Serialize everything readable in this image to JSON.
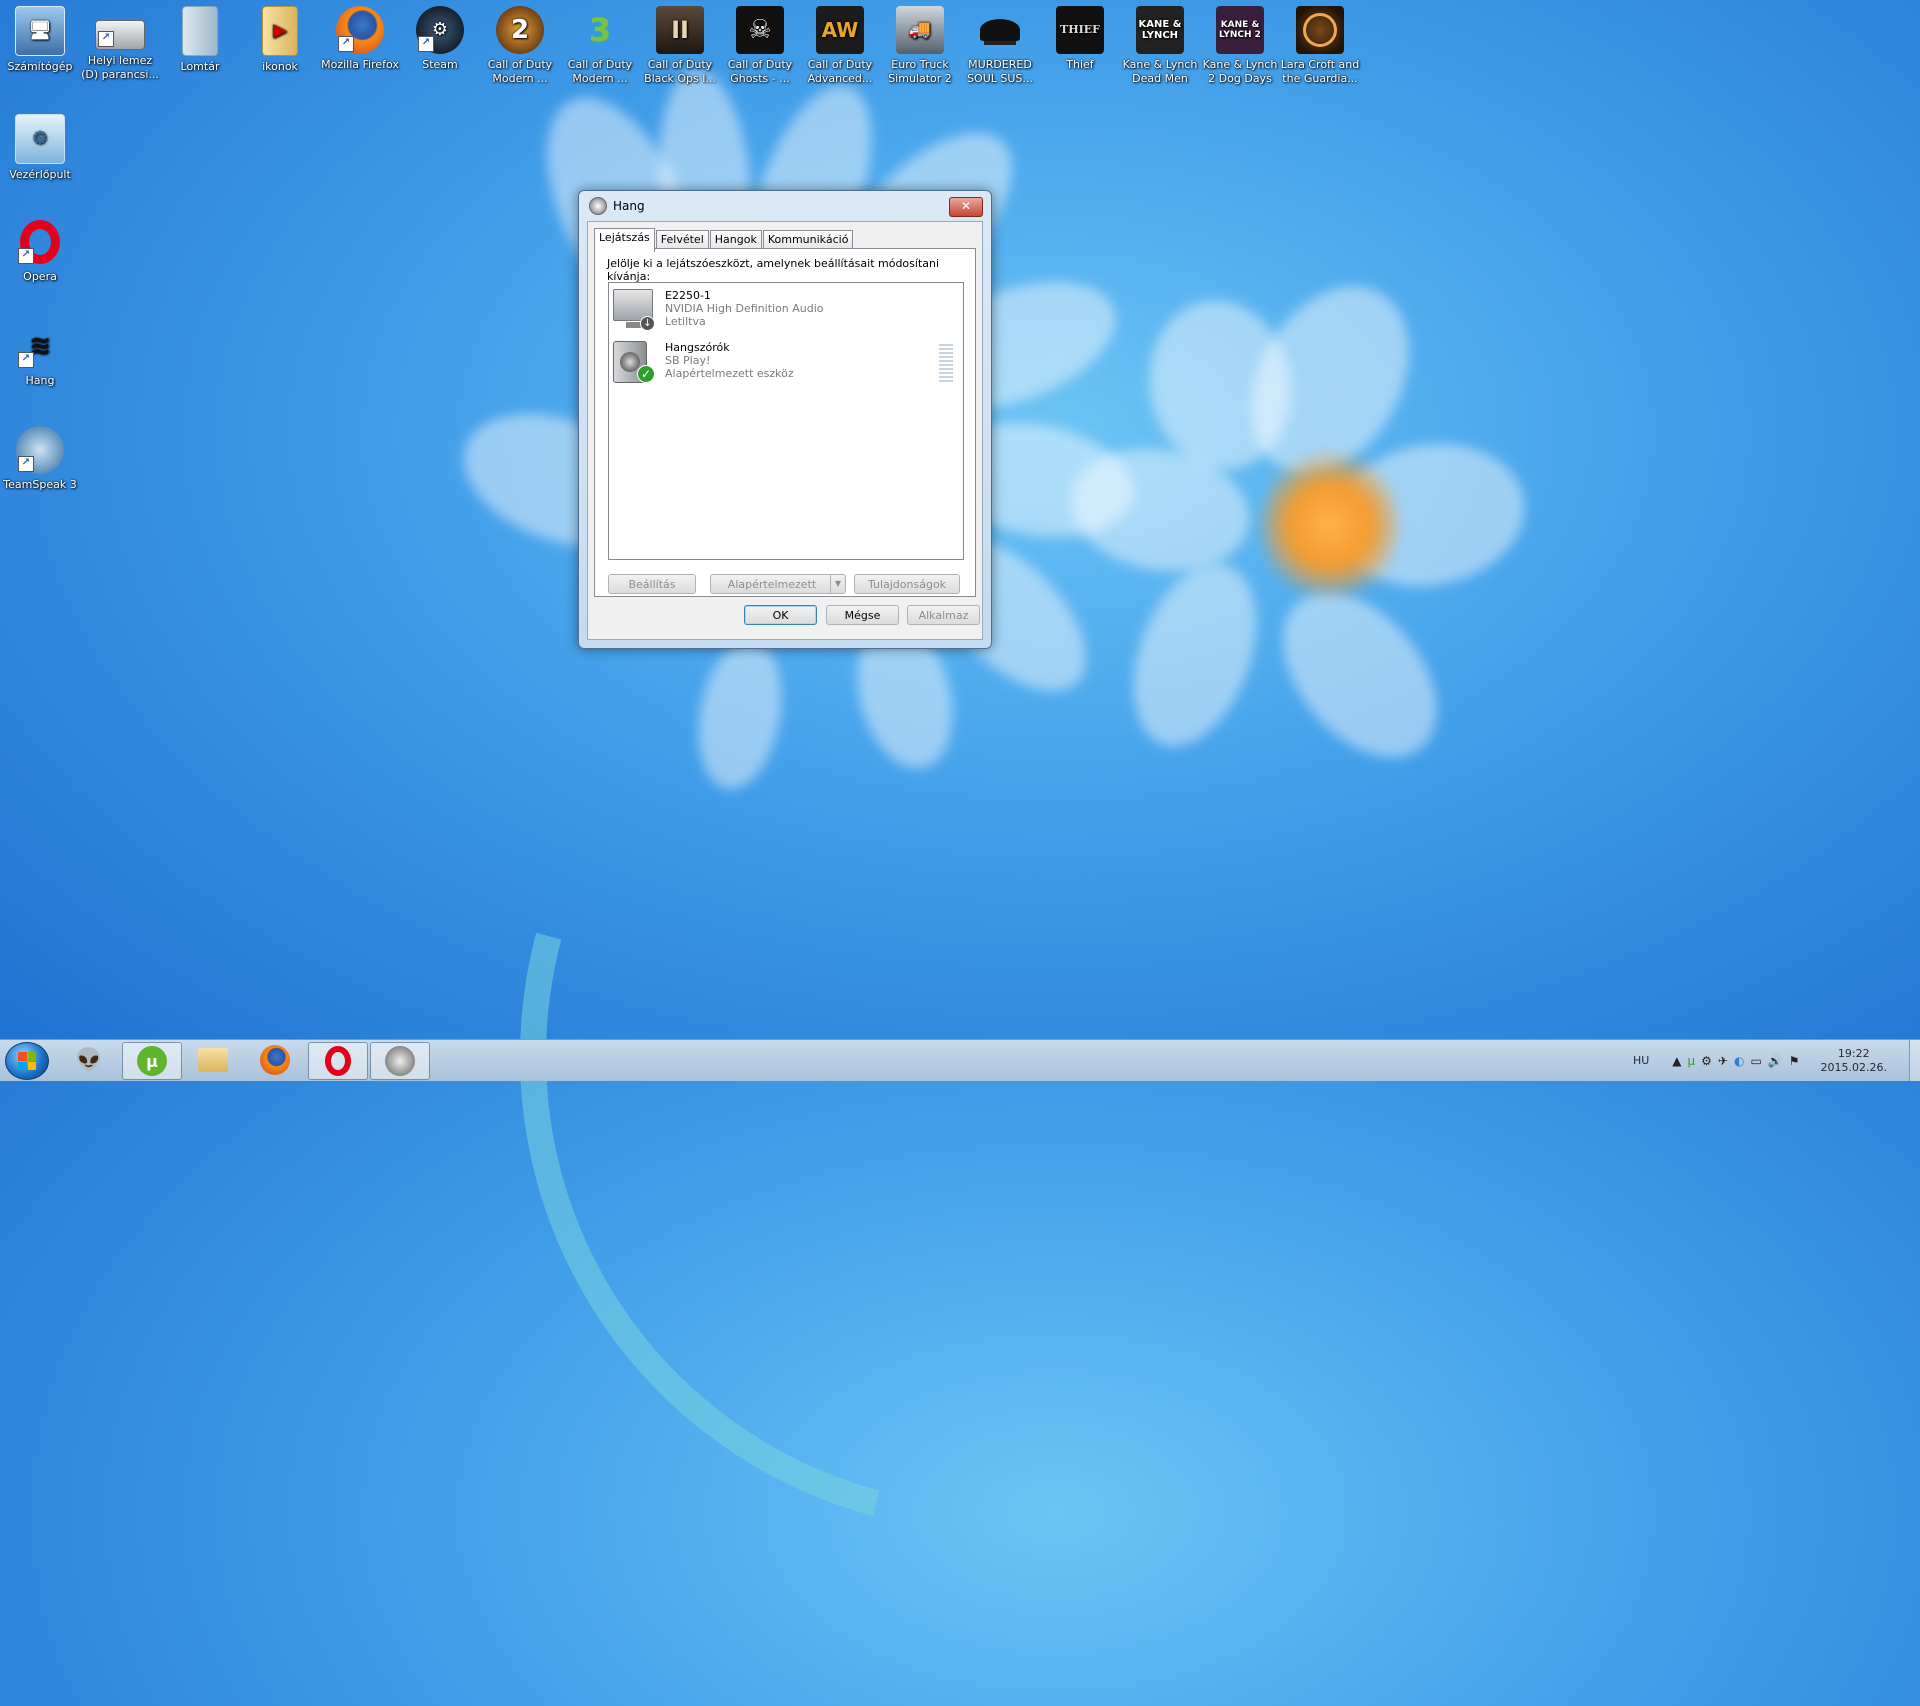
{
  "desktop": {
    "icons_left": [
      {
        "label": "Számítógép",
        "glyph": "computer-icon"
      },
      {
        "label": "Vezérlőpult",
        "glyph": "control-panel-icon"
      },
      {
        "label": "Opera",
        "glyph": "opera-icon"
      },
      {
        "label": "Hang",
        "glyph": "hang-icon"
      },
      {
        "label": "TeamSpeak 3",
        "glyph": "teamspeak-icon"
      }
    ],
    "icons_top": [
      {
        "label": "Helyi lemez (D) parancsi...",
        "glyph": "drive-icon"
      },
      {
        "label": "Lomtár",
        "glyph": "recycle-bin-icon"
      },
      {
        "label": "ikonok",
        "glyph": "folder-icon"
      },
      {
        "label": "Mozilla Firefox",
        "glyph": "firefox-icon"
      },
      {
        "label": "Steam",
        "glyph": "steam-icon"
      },
      {
        "label": "Call of Duty Modern ...",
        "glyph": "game-icon"
      },
      {
        "label": "Call of Duty Modern ...",
        "glyph": "game-icon"
      },
      {
        "label": "Call of Duty Black Ops I...",
        "glyph": "game-icon"
      },
      {
        "label": "Call of Duty Ghosts - ...",
        "glyph": "game-icon"
      },
      {
        "label": "Call of Duty Advanced...",
        "glyph": "game-icon"
      },
      {
        "label": "Euro Truck Simulator 2",
        "glyph": "game-icon"
      },
      {
        "label": "MURDERED SOUL SUS...",
        "glyph": "game-icon"
      },
      {
        "label": "Thief",
        "glyph": "game-icon"
      },
      {
        "label": "Kane & Lynch Dead Men",
        "glyph": "game-icon"
      },
      {
        "label": "Kane & Lynch 2 Dog Days",
        "glyph": "game-icon"
      },
      {
        "label": "Lara Croft and the Guardia...",
        "glyph": "game-icon"
      }
    ],
    "icon_text": {
      "cod2": "2",
      "cod3": "3",
      "bo": "II",
      "aw": "AW",
      "thief": "THIEF",
      "kl": "KANE & LYNCH",
      "kl2": "KANE & LYNCH 2"
    }
  },
  "dialog": {
    "title": "Hang",
    "close_label": "✕",
    "tabs": [
      "Lejátszás",
      "Felvétel",
      "Hangok",
      "Kommunikáció"
    ],
    "instruction": "Jelölje ki a lejátszóeszközt, amelynek beállításait módosítani kívánja:",
    "devices": [
      {
        "name": "E2250-1",
        "driver": "NVIDIA High Definition Audio",
        "status": "Letiltva"
      },
      {
        "name": "Hangszórók",
        "driver": "SB Play!",
        "status": "Alapértelmezett eszköz"
      }
    ],
    "buttons": {
      "configure": "Beállítás",
      "set_default": "Alapértelmezett",
      "properties": "Tulajdonságok",
      "ok": "OK",
      "cancel": "Mégse",
      "apply": "Alkalmaz"
    }
  },
  "taskbar": {
    "language": "HU",
    "time": "19:22",
    "date": "2015.02.26."
  },
  "colors": {
    "wallpaper": "#3f9ce8",
    "taskbar": "#b9cfe5",
    "opera": "#e3001b"
  }
}
